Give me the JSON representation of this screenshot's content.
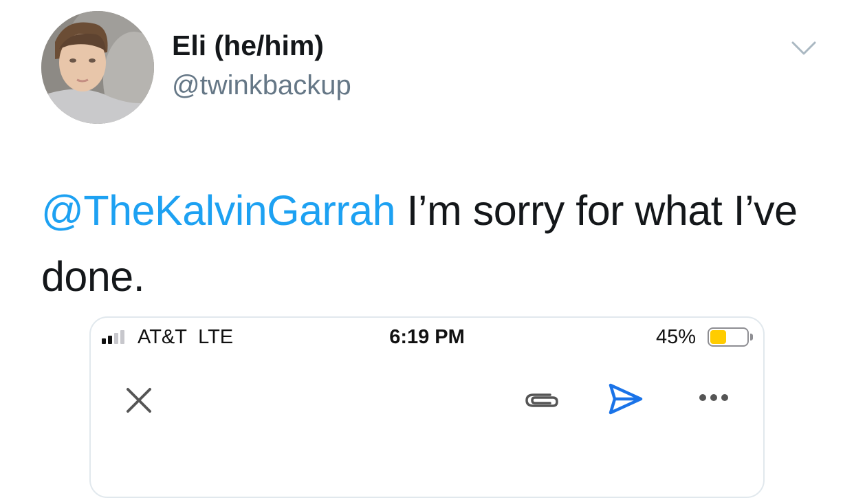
{
  "tweet": {
    "author": {
      "display_name": "Eli (he/him)",
      "handle": "@twinkbackup",
      "avatar_icon": "profile-photo"
    },
    "menu_icon": "chevron-down-icon",
    "mention": "@TheKalvinGarrah",
    "body": " I’m sorry for what I’ve done.",
    "colors": {
      "link": "#1da1f2",
      "text": "#14171a",
      "secondary": "#657786"
    }
  },
  "screenshot": {
    "status_bar": {
      "carrier": "AT&T",
      "network": "LTE",
      "time": "6:19 PM",
      "battery_percent_text": "45%",
      "battery_level": 0.45,
      "battery_color": "#ffcc00"
    },
    "toolbar": {
      "close_icon": "close-icon",
      "attach_icon": "paperclip-icon",
      "send_icon": "send-icon",
      "more_icon": "more-icon",
      "send_color": "#1a73e8"
    }
  }
}
